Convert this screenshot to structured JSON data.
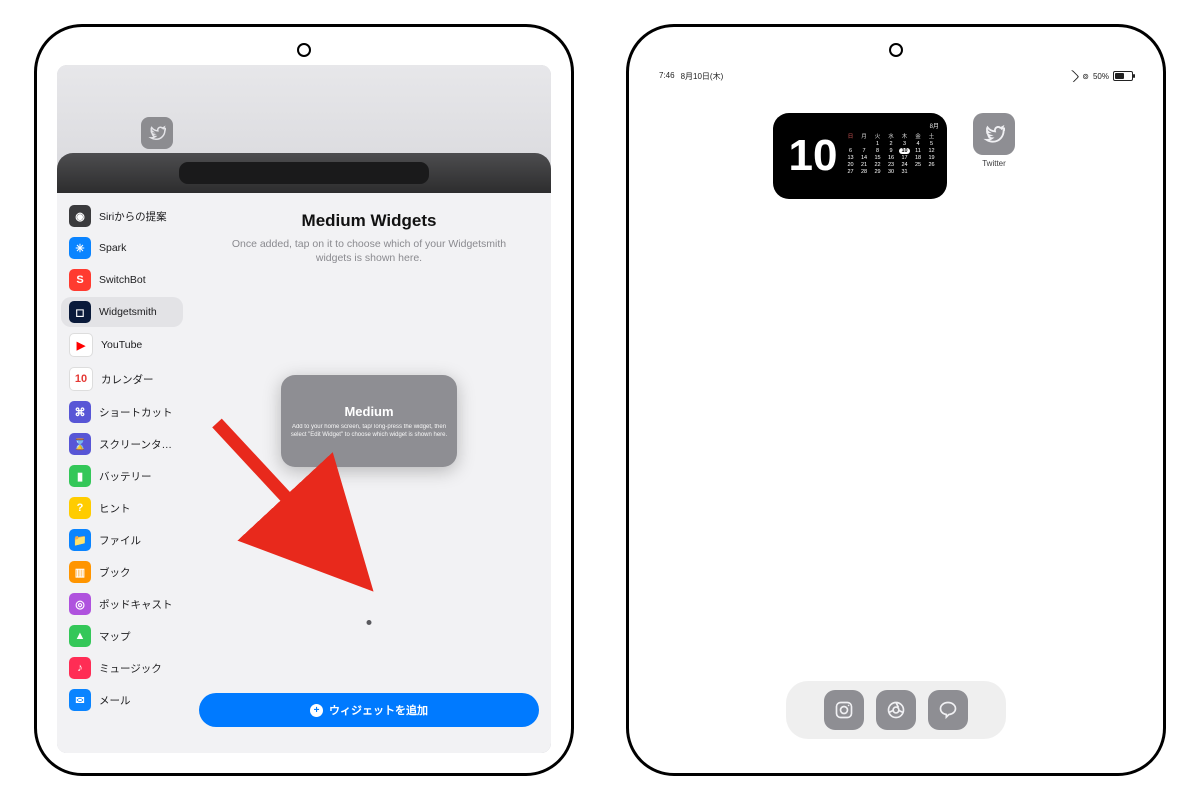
{
  "left": {
    "sidebar_apps": [
      {
        "label": "Siriからの提案",
        "bg": "#3b3b3d",
        "glyph": "◉"
      },
      {
        "label": "Spark",
        "bg": "#0a84ff",
        "glyph": "✳"
      },
      {
        "label": "SwitchBot",
        "bg": "#ff3b30",
        "glyph": "S"
      },
      {
        "label": "Widgetsmith",
        "bg": "#0a1a3a",
        "glyph": "◻",
        "selected": true
      },
      {
        "label": "YouTube",
        "bg": "#ffffff",
        "glyph": "▶",
        "glyphColor": "#ff0000"
      },
      {
        "label": "カレンダー",
        "bg": "#ffffff",
        "glyph": "10",
        "glyphColor": "#e53935",
        "square": true
      },
      {
        "label": "ショートカット",
        "bg": "#5856d6",
        "glyph": "⌘"
      },
      {
        "label": "スクリーンタ…",
        "bg": "#5856d6",
        "glyph": "⌛"
      },
      {
        "label": "バッテリー",
        "bg": "#34c759",
        "glyph": "▮"
      },
      {
        "label": "ヒント",
        "bg": "#ffcc00",
        "glyph": "?"
      },
      {
        "label": "ファイル",
        "bg": "#0a84ff",
        "glyph": "📁"
      },
      {
        "label": "ブック",
        "bg": "#ff9500",
        "glyph": "▥"
      },
      {
        "label": "ポッドキャスト",
        "bg": "#af52de",
        "glyph": "◎"
      },
      {
        "label": "マップ",
        "bg": "#34c759",
        "glyph": "▲"
      },
      {
        "label": "ミュージック",
        "bg": "#ff2d55",
        "glyph": "♪"
      },
      {
        "label": "メール",
        "bg": "#0a84ff",
        "glyph": "✉"
      }
    ],
    "title": "Medium Widgets",
    "subtitle": "Once added, tap on it to choose which of your Widgetsmith widgets is shown here.",
    "widget_card": {
      "title": "Medium",
      "body": "Add to your home screen, tap/\nlong-press the widget, then\nselect \"Edit Widget\" to choose\nwhich widget is shown here."
    },
    "add_button_label": "ウィジェットを追加",
    "arrow_color": "#e8291c"
  },
  "right": {
    "status": {
      "time": "7:46",
      "date": "8月10日(木)",
      "battery_pct": "50%"
    },
    "calendar_widget": {
      "today": "10",
      "month_label": "8月",
      "dows": [
        "日",
        "月",
        "火",
        "水",
        "木",
        "金",
        "土"
      ],
      "weeks": [
        [
          "",
          "",
          "1",
          "2",
          "3",
          "4",
          "5"
        ],
        [
          "6",
          "7",
          "8",
          "9",
          "10",
          "11",
          "12"
        ],
        [
          "13",
          "14",
          "15",
          "16",
          "17",
          "18",
          "19"
        ],
        [
          "20",
          "21",
          "22",
          "23",
          "24",
          "25",
          "26"
        ],
        [
          "27",
          "28",
          "29",
          "30",
          "31",
          "",
          ""
        ]
      ],
      "today_cell": "10"
    },
    "twitter_label": "Twitter",
    "dock": [
      "instagram",
      "chrome",
      "line"
    ]
  }
}
